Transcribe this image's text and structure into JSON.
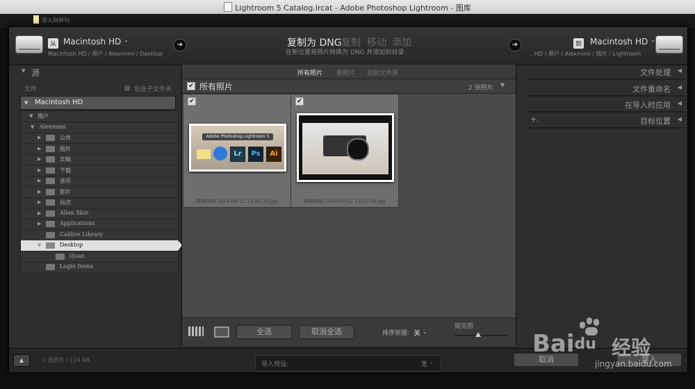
{
  "window_title": "Lightroom 5 Catalog.lrcat - Adobe Photoshop Lightroom - 图库",
  "background_note": "导入到并刊",
  "header": {
    "source_chip": "从",
    "source_volume": "Macintosh HD",
    "source_path": "Macintosh HD / 用户 / Alexmimi / Desktop",
    "modes": [
      "复制为 DNG",
      "复制",
      "移动",
      "添加"
    ],
    "mode_description": "在新位置将照片转换为 DNG 并添加到目录",
    "dest_chip": "到",
    "dest_volume": "Macintosh HD",
    "dest_path": "…HD / 用户 / Alexmimi / 图片 / Lightroom"
  },
  "left_panel": {
    "title": "源",
    "files_label": "文件",
    "include_subfolders": "包含子文件夹",
    "volume": "Macintosh HD",
    "tree": [
      {
        "label": "用户",
        "level": 0,
        "state": "open"
      },
      {
        "label": "Alexmimi",
        "level": 1,
        "state": "open"
      },
      {
        "label": "公共",
        "level": 2,
        "state": "closed"
      },
      {
        "label": "图片",
        "level": 2,
        "state": "closed"
      },
      {
        "label": "文稿",
        "level": 2,
        "state": "closed"
      },
      {
        "label": "下载",
        "level": 2,
        "state": "closed"
      },
      {
        "label": "音乐",
        "level": 2,
        "state": "closed"
      },
      {
        "label": "影片",
        "level": 2,
        "state": "closed"
      },
      {
        "label": "站点",
        "level": 2,
        "state": "closed"
      },
      {
        "label": "Alien Skin",
        "level": 2,
        "state": "closed"
      },
      {
        "label": "Applications",
        "level": 2,
        "state": "closed"
      },
      {
        "label": "Calibre Library",
        "level": 2,
        "state": "none"
      },
      {
        "label": "Desktop",
        "level": 2,
        "state": "open",
        "selected": true
      },
      {
        "label": "Quan",
        "level": 3,
        "state": "none"
      },
      {
        "label": "Login Items",
        "level": 2,
        "state": "none"
      }
    ]
  },
  "center": {
    "tabs": [
      "所有照片",
      "新照片",
      "目标文件夹"
    ],
    "grid_title": "所有照片",
    "photo_count": "2 张照片",
    "photos": [
      {
        "filename": "屏幕快照 2014-09-22 13.04.39.jpg",
        "banner": "Adobe Photoshop Lightroom 5",
        "apps": [
          "Lr",
          "Ps",
          "Ai"
        ]
      },
      {
        "filename": "屏幕快照 2014-09-22 13.05.00.jpg"
      }
    ],
    "toolbar": {
      "check_all": "全选",
      "uncheck_all": "取消全选",
      "sort_label": "排序依据:",
      "sort_value": "关",
      "thumb_label": "缩览图",
      "thumb_size": 0.45
    }
  },
  "right_panel": {
    "sections": [
      "文件处理",
      "文件重命名",
      "在导入时应用",
      "目标位置"
    ]
  },
  "footer": {
    "summary": "2 张照片 / 124 KB",
    "preset_label": "导入预设:",
    "preset_value": "无",
    "cancel": "取消",
    "import": "导入"
  },
  "watermark": {
    "brand": "Bai",
    "brand2": "du",
    "brand3": "经验",
    "site": "jingyan.baidu.com"
  },
  "colors": {
    "selected_row": "#e0e0e0",
    "panel": "#2e2e2e",
    "grid": "#4a4a4a"
  }
}
